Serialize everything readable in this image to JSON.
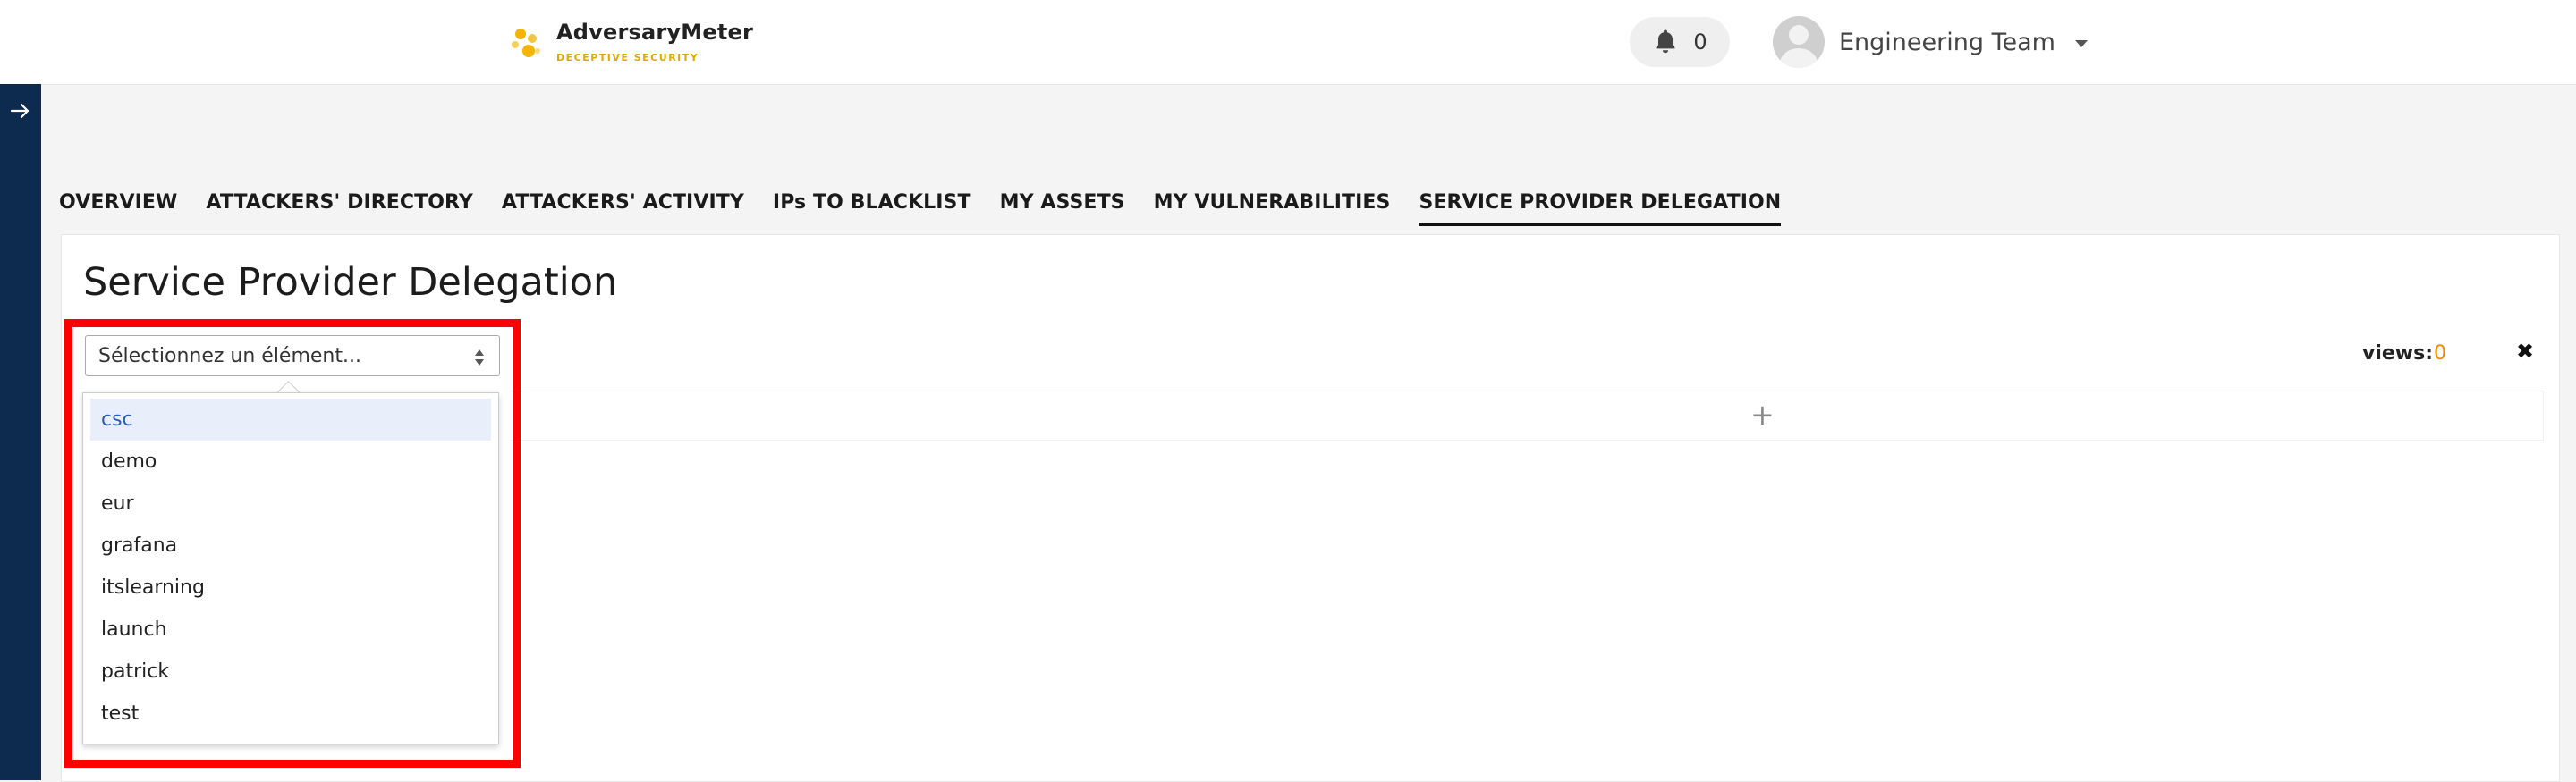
{
  "header": {
    "brand": "AdversaryMeter",
    "tagline": "DECEPTIVE SECURITY",
    "notifications_count": "0",
    "user_name": "Engineering Team",
    "icons": {
      "logo": "adversarymeter-logo-icon",
      "bell": "bell-icon",
      "avatar": "user-avatar-icon",
      "caret": "caret-down-icon"
    }
  },
  "rail": {
    "icon": "arrow-right-icon"
  },
  "tabs": [
    {
      "label": "OVERVIEW",
      "active": false
    },
    {
      "label": "ATTACKERS' DIRECTORY",
      "active": false
    },
    {
      "label": "ATTACKERS' ACTIVITY",
      "active": false
    },
    {
      "label": "IPs TO BLACKLIST",
      "active": false
    },
    {
      "label": "MY ASSETS",
      "active": false
    },
    {
      "label": "MY VULNERABILITIES",
      "active": false
    },
    {
      "label": "SERVICE PROVIDER DELEGATION",
      "active": true
    }
  ],
  "main": {
    "title": "Service Provider Delegation",
    "select": {
      "placeholder": "Sélectionnez un élément...",
      "options": [
        "csc",
        "demo",
        "eur",
        "grafana",
        "itslearning",
        "launch",
        "patrick",
        "test"
      ],
      "highlighted_option": "csc"
    },
    "add_symbol": "+",
    "views_label": "views:",
    "views_count": "0",
    "close_symbol": "✖"
  },
  "colors": {
    "rail": "#0d2b4e",
    "accent_orange": "#f08a00",
    "highlight_box": "#ff0000",
    "option_highlight_bg": "#e8eefa",
    "option_highlight_text": "#2a5db0"
  }
}
